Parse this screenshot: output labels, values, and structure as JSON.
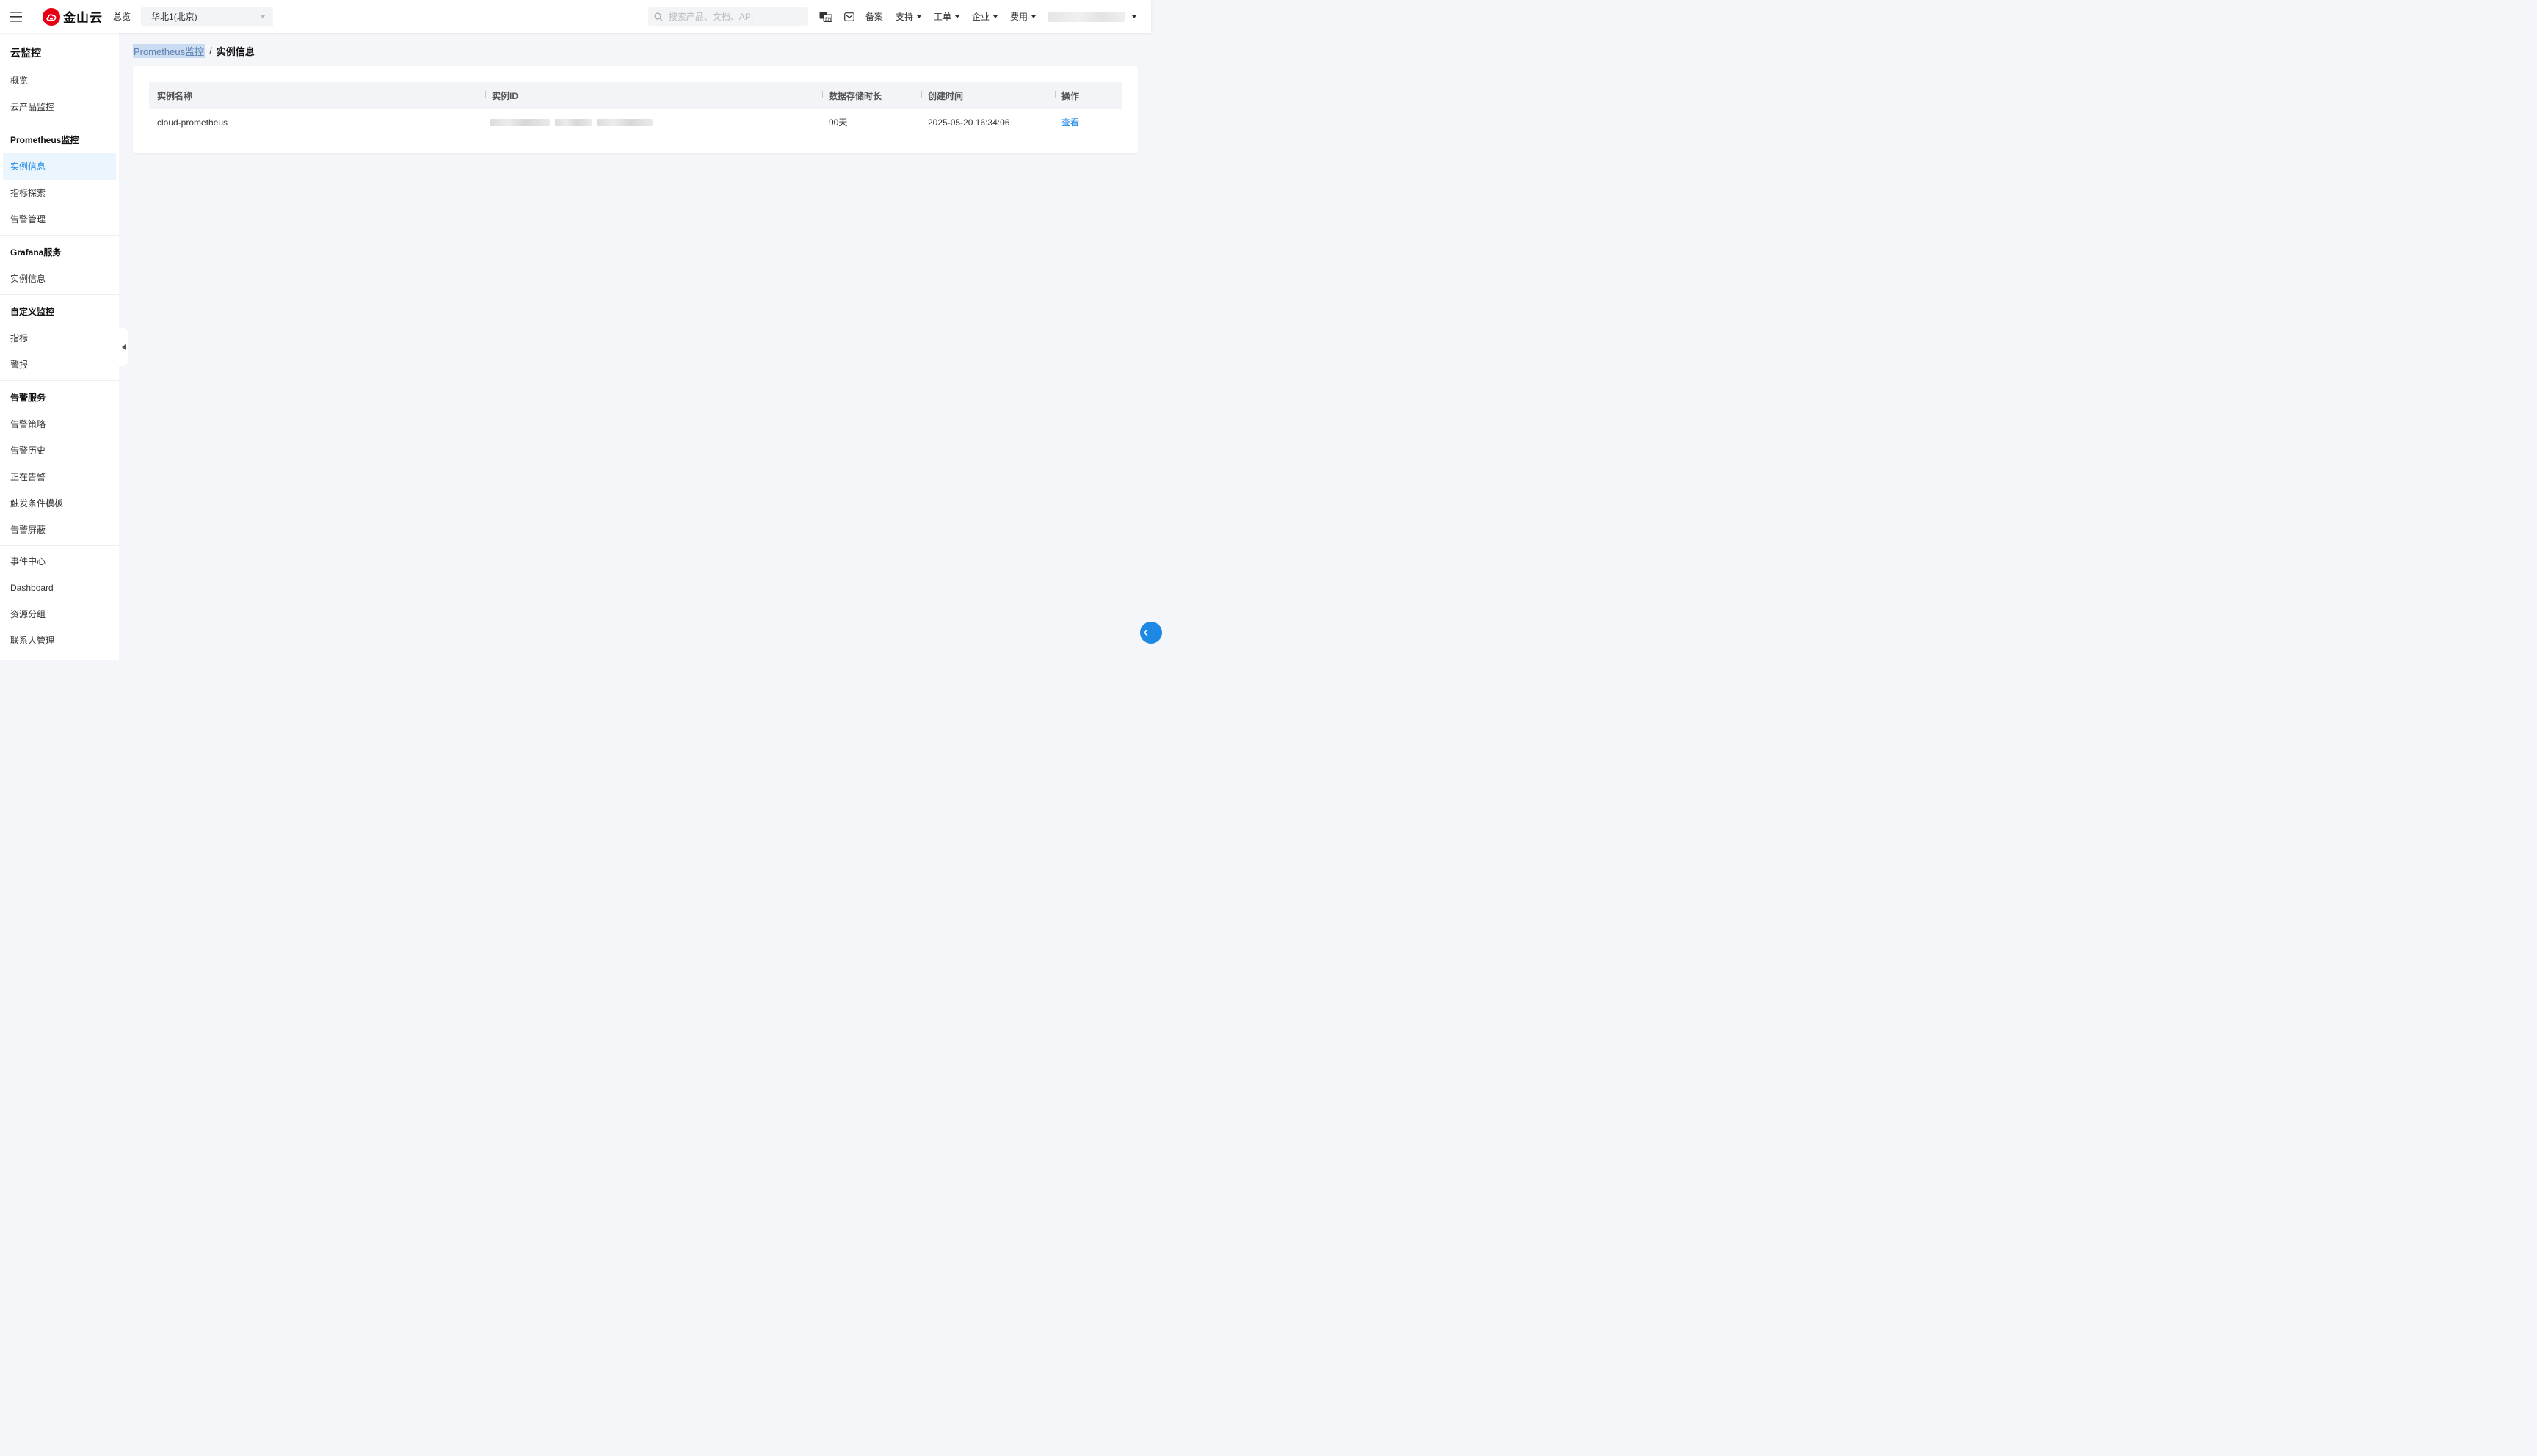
{
  "topbar": {
    "brand": "金山云",
    "overview": "总览",
    "region": "华北1(北京)",
    "search_placeholder": "搜索产品、文档、API",
    "beian": "备案",
    "menus": [
      "支持",
      "工单",
      "企业",
      "费用"
    ]
  },
  "sidebar": {
    "title": "云监控",
    "top_items": [
      "概览",
      "云产品监控"
    ],
    "groups": [
      {
        "label": "Prometheus监控",
        "items": [
          "实例信息",
          "指标探索",
          "告警管理"
        ]
      },
      {
        "label": "Grafana服务",
        "items": [
          "实例信息"
        ]
      },
      {
        "label": "自定义监控",
        "items": [
          "指标",
          "警报"
        ]
      },
      {
        "label": "告警服务",
        "items": [
          "告警策略",
          "告警历史",
          "正在告警",
          "触发条件模板",
          "告警屏蔽"
        ]
      }
    ],
    "bottom_items": [
      "事件中心",
      "Dashboard",
      "资源分组",
      "联系人管理"
    ]
  },
  "breadcrumb": {
    "parent": "Prometheus监控",
    "separator": "/",
    "current": "实例信息"
  },
  "table": {
    "columns": [
      "实例名称",
      "实例ID",
      "数据存储时长",
      "创建时间",
      "操作"
    ],
    "rows": [
      {
        "name": "cloud-prometheus",
        "retention": "90天",
        "created": "2025-05-20 16:34:06",
        "action": "查看"
      }
    ]
  }
}
